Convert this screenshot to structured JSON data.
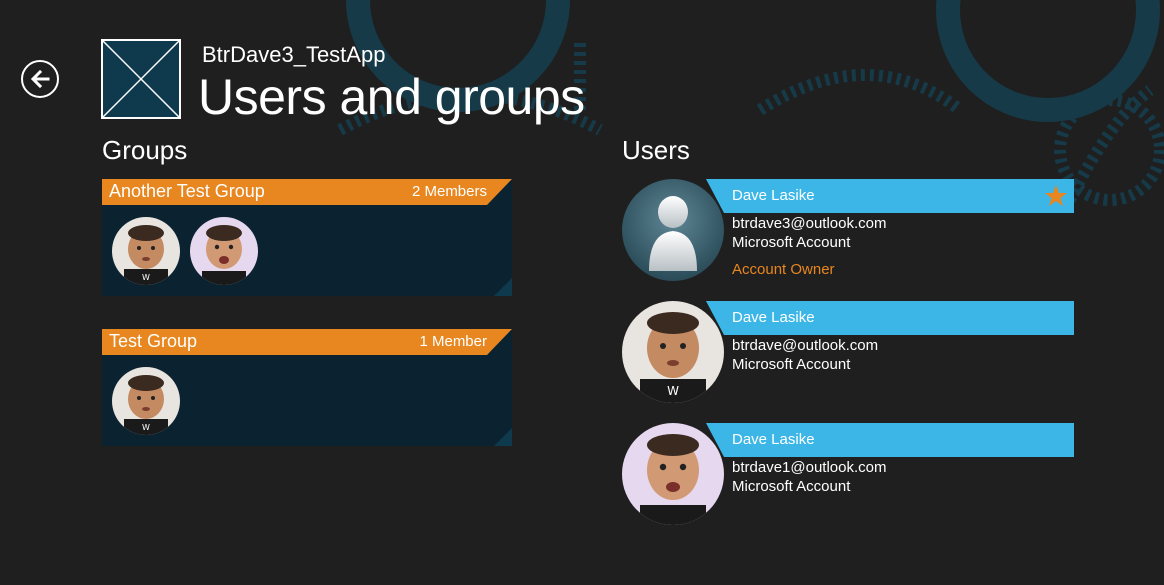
{
  "header": {
    "app_name": "BtrDave3_TestApp",
    "page_title": "Users and groups",
    "back_icon": "back-arrow-icon",
    "logo_icon": "app-logo-placeholder"
  },
  "groups_section": {
    "title": "Groups",
    "groups": [
      {
        "name": "Another Test Group",
        "member_count": "2 Members"
      },
      {
        "name": "Test Group",
        "member_count": "1 Member"
      }
    ]
  },
  "users_section": {
    "title": "Users",
    "users": [
      {
        "name": "Dave Lasike",
        "email": "btrdave3@outlook.com",
        "account_type": "Microsoft Account",
        "role": "Account Owner",
        "is_owner": true
      },
      {
        "name": "Dave Lasike",
        "email": "btrdave@outlook.com",
        "account_type": "Microsoft Account",
        "role": "",
        "is_owner": false
      },
      {
        "name": "Dave Lasike",
        "email": "btrdave1@outlook.com",
        "account_type": "Microsoft Account",
        "role": "",
        "is_owner": false
      }
    ]
  },
  "colors": {
    "background": "#1f1f1f",
    "group_header": "#e8861f",
    "group_tile": "#0b2230",
    "user_bar": "#3bb6e7",
    "owner_label": "#e8861f",
    "decoration": "#17404f"
  }
}
